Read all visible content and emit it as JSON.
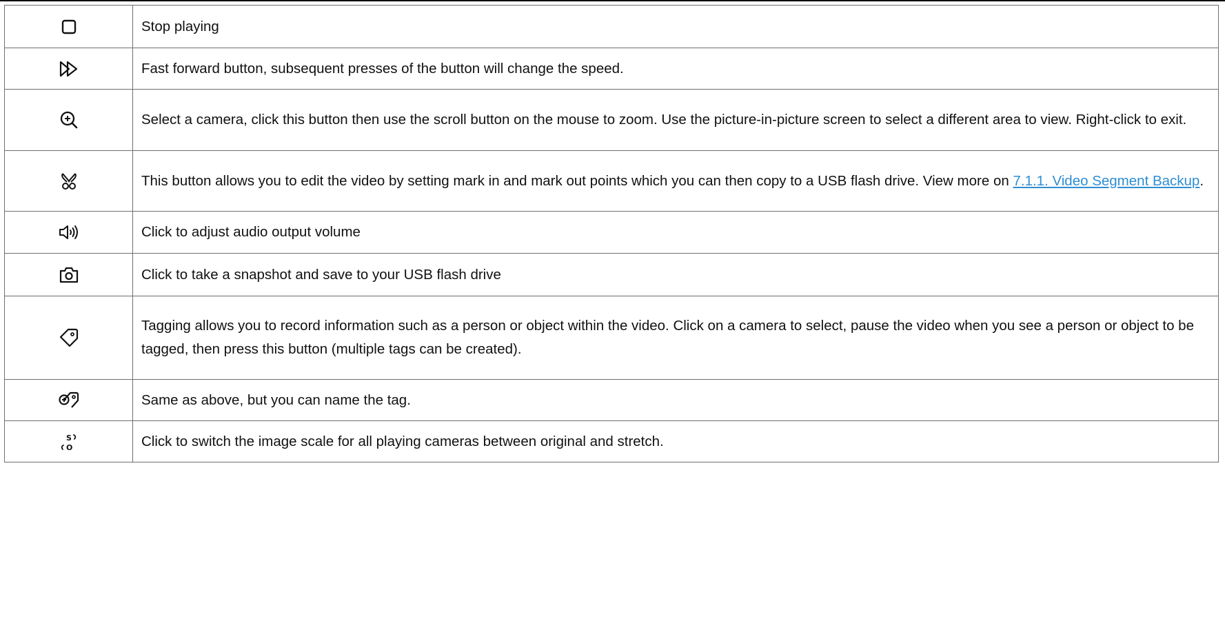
{
  "rows": [
    {
      "icon": "stop-icon",
      "text": "Stop playing"
    },
    {
      "icon": "fast-forward-icon",
      "text": "Fast forward button, subsequent presses of the button will change the speed."
    },
    {
      "icon": "zoom-in-icon",
      "text": "Select a camera, click this button then use the scroll button on the mouse to zoom. Use the picture-in-picture screen to select a different area to view. Right-click to exit."
    },
    {
      "icon": "scissors-icon",
      "text_before": "This button allows you to edit the video by setting mark in and mark out points which you can then copy to a USB flash drive. View more on ",
      "link": "7.1.1. Video Segment Backup",
      "text_after": "."
    },
    {
      "icon": "speaker-icon",
      "text": "Click to adjust audio output volume"
    },
    {
      "icon": "camera-icon",
      "text": "Click to take a snapshot and save to your USB flash drive"
    },
    {
      "icon": "tag-icon",
      "text": "Tagging allows you to record information such as a person or object within the video. Click on a camera to select, pause the video when you see a person or object to be tagged, then press this button (multiple tags can be created)."
    },
    {
      "icon": "tag-add-icon",
      "text": "Same as above, but you can name the tag."
    },
    {
      "icon": "scale-switch-icon",
      "text": "Click to switch the image scale for all playing cameras between original and stretch."
    }
  ],
  "colors": {
    "link": "#2e8ed3",
    "border": "#6e6e6e",
    "text": "#111111"
  }
}
